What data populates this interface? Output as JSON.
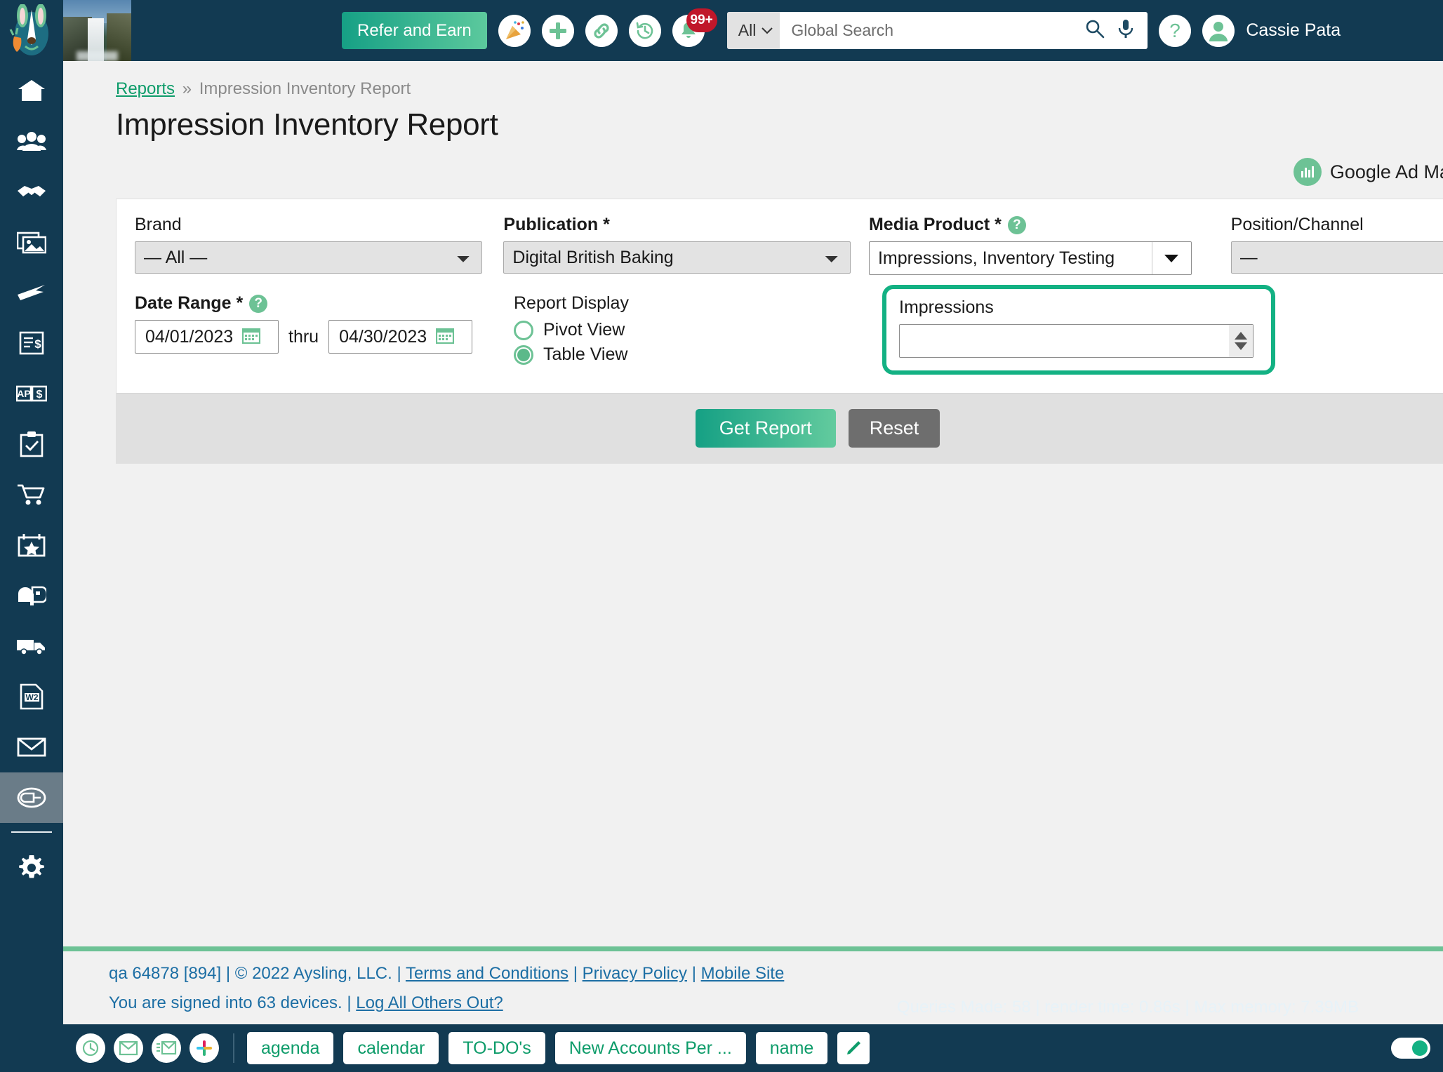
{
  "topbar": {
    "refer_label": "Refer and Earn",
    "icons": [
      "celebration-icon",
      "plus-icon",
      "link-icon",
      "history-icon",
      "bell-icon"
    ],
    "notification_badge": "99+",
    "search_scope": "All",
    "search_placeholder": "Global Search",
    "search_value": "",
    "help_label": "?",
    "username": "Cassie Pata",
    "accent_green": "#16a085",
    "bar_color": "#123a52"
  },
  "sidebar": {
    "items": [
      {
        "name": "home",
        "icon": "home-icon"
      },
      {
        "name": "contacts",
        "icon": "people-icon"
      },
      {
        "name": "deals",
        "icon": "handshake-icon"
      },
      {
        "name": "media",
        "icon": "images-icon"
      },
      {
        "name": "production",
        "icon": "paper-plane-icon"
      },
      {
        "name": "invoices",
        "icon": "invoice-dollar-icon"
      },
      {
        "name": "accounts-payable",
        "icon": "ap-money-icon"
      },
      {
        "name": "tasks",
        "icon": "clipboard-check-icon"
      },
      {
        "name": "orders",
        "icon": "shopping-cart-icon"
      },
      {
        "name": "events",
        "icon": "star-calendar-icon"
      },
      {
        "name": "mailbox",
        "icon": "mailbox-icon"
      },
      {
        "name": "shipping",
        "icon": "truck-icon"
      },
      {
        "name": "w2",
        "icon": "w2-document-icon"
      },
      {
        "name": "email",
        "icon": "envelope-icon"
      },
      {
        "name": "reports",
        "icon": "reports-icon"
      }
    ],
    "active_index": 14,
    "settings": {
      "name": "settings",
      "icon": "gear-icon"
    }
  },
  "breadcrumb": {
    "parent": "Reports",
    "separator": "»",
    "current": "Impression Inventory Report"
  },
  "page_title": "Impression Inventory Report",
  "integration": {
    "icon": "bar-chart-icon",
    "label": "Google Ad Ma"
  },
  "form": {
    "brand": {
      "label": "Brand",
      "value": "— All —",
      "options": [
        "— All —"
      ]
    },
    "publication": {
      "label": "Publication *",
      "value": "Digital British Baking",
      "options": [
        "Digital British Baking"
      ]
    },
    "media_product": {
      "label": "Media Product *",
      "help": "?",
      "value": "Impressions, Inventory Testing"
    },
    "position_channel": {
      "label": "Position/Channel",
      "value": "—",
      "options": [
        "—"
      ]
    },
    "date_range": {
      "label": "Date Range *",
      "help": "?",
      "from": "04/01/2023",
      "thru_label": "thru",
      "to": "04/30/2023",
      "calendar_icon": "calendar-icon"
    },
    "report_display": {
      "label": "Report Display",
      "options": [
        {
          "label": "Pivot View",
          "selected": false
        },
        {
          "label": "Table View",
          "selected": true
        }
      ]
    },
    "impressions": {
      "label": "Impressions",
      "value": "",
      "highlighted": true,
      "highlight_color": "#13b183"
    },
    "actions": {
      "get_report": "Get Report",
      "reset": "Reset"
    }
  },
  "footer": {
    "build": "qa 64878 [894]",
    "copyright": "© 2022 Aysling, LLC.",
    "terms": "Terms and Conditions",
    "privacy": "Privacy Policy",
    "mobile": "Mobile Site",
    "devices_text": "You are signed into 63 devices.",
    "logout_link": "Log All Others Out?",
    "stats": "Queries Made: 58 | render time: 0.86s | Max memory: 7.39MB"
  },
  "taskbar": {
    "icons": [
      "clock-icon",
      "envelope-icon",
      "envelope-list-icon",
      "slack-icon"
    ],
    "chips": [
      "agenda",
      "calendar",
      "TO-DO's",
      "New Accounts Per ...",
      "name"
    ],
    "pencil_icon": "pencil-icon",
    "toggle_on": true
  }
}
